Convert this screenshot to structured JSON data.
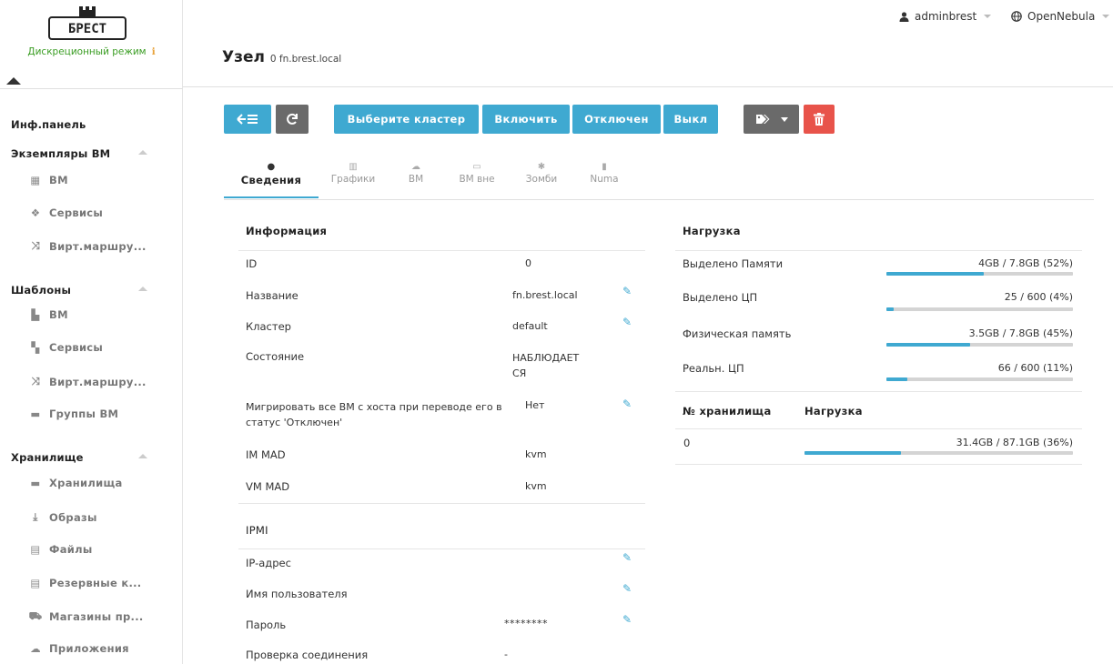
{
  "logo": {
    "text": "БРЕСТ",
    "mode": "Дискреционный режим",
    "info_glyph": "ℹ"
  },
  "sidebar": {
    "dashboard": "Инф.панель",
    "groups": [
      {
        "label": "Экземпляры ВМ",
        "items": [
          "ВМ",
          "Сервисы",
          "Вирт.маршру..."
        ]
      },
      {
        "label": "Шаблоны",
        "items": [
          "ВМ",
          "Сервисы",
          "Вирт.маршру...",
          "Группы ВМ"
        ]
      },
      {
        "label": "Хранилище",
        "items": [
          "Хранилища",
          "Образы",
          "Файлы",
          "Резервные к...",
          "Магазины пр...",
          "Приложения"
        ]
      }
    ]
  },
  "header": {
    "user": "adminbrest",
    "zone": "OpenNebula",
    "title": "Узел",
    "subtitle": "0 fn.brest.local"
  },
  "toolbar": {
    "cluster_label": "Выберите кластер",
    "enable_label": "Включить",
    "disable_label": "Отключен",
    "off_label": "Выкл"
  },
  "tabs": [
    {
      "label": "Сведения",
      "icon": "info-icon"
    },
    {
      "label": "Графики",
      "icon": "chart-icon"
    },
    {
      "label": "ВМ",
      "icon": "cloud-icon"
    },
    {
      "label": "ВМ вне",
      "icon": "drive-icon"
    },
    {
      "label": "Зомби",
      "icon": "bug-icon"
    },
    {
      "label": "Numa",
      "icon": "chip-icon"
    }
  ],
  "info": {
    "title": "Информация",
    "rows": [
      {
        "label": "ID",
        "value": "0"
      },
      {
        "label": "Название",
        "value": "fn.brest.local"
      },
      {
        "label": "Кластер",
        "value": "default"
      },
      {
        "label": "Состояние",
        "value_line1": "НАБЛЮДАЕТ",
        "value_line2": "СЯ"
      },
      {
        "label_line1": "Мигрировать все ВМ с хоста при переводе его в",
        "label_line2": "статус 'Отключен'",
        "value": "Нет"
      },
      {
        "label": "IM MAD",
        "value": "kvm"
      },
      {
        "label": "VM MAD",
        "value": "kvm"
      }
    ]
  },
  "ipmi": {
    "title": "IPMI",
    "rows": [
      {
        "label": "IP-адрес",
        "value": ""
      },
      {
        "label": "Имя пользователя",
        "value": ""
      },
      {
        "label": "Пароль",
        "value": "********"
      },
      {
        "label": "Проверка соединения",
        "value": "-"
      }
    ]
  },
  "load": {
    "title": "Нагрузка",
    "rows": [
      {
        "label": "Выделено Памяти",
        "text": "4GB / 7.8GB (52%)",
        "percent": 52
      },
      {
        "label": "Выделено ЦП",
        "text": "25 / 600 (4%)",
        "percent": 4
      },
      {
        "label": "Физическая память",
        "text": "3.5GB / 7.8GB (45%)",
        "percent": 45
      },
      {
        "label": "Реальн. ЦП",
        "text": "66 / 600 (11%)",
        "percent": 11
      }
    ]
  },
  "datastores": {
    "col_id": "№ хранилища",
    "col_load": "Нагрузка",
    "rows": [
      {
        "id": "0",
        "text": "31.4GB / 87.1GB (36%)",
        "percent": 36
      }
    ]
  }
}
